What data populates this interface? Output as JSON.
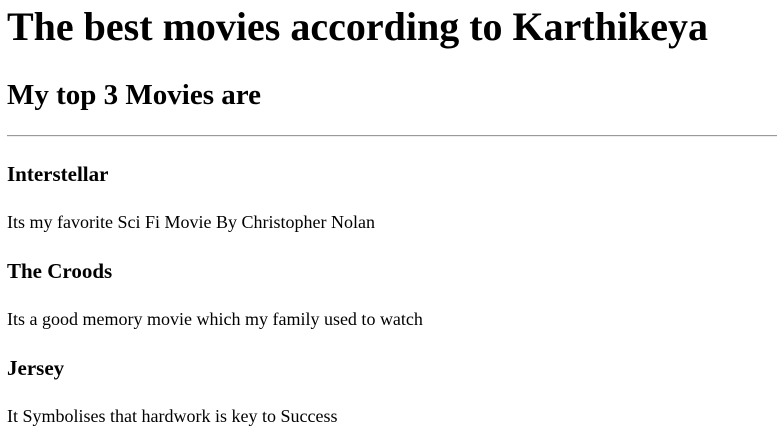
{
  "page": {
    "title": "The best movies according to Karthikeya",
    "subtitle": "My top 3 Movies are"
  },
  "movies": [
    {
      "title": "Interstellar",
      "description": "Its my favorite Sci Fi Movie By Christopher Nolan"
    },
    {
      "title": "The Croods",
      "description": "Its a good memory movie which my family used to watch"
    },
    {
      "title": "Jersey",
      "description": "It Symbolises that hardwork is key to Success"
    }
  ]
}
